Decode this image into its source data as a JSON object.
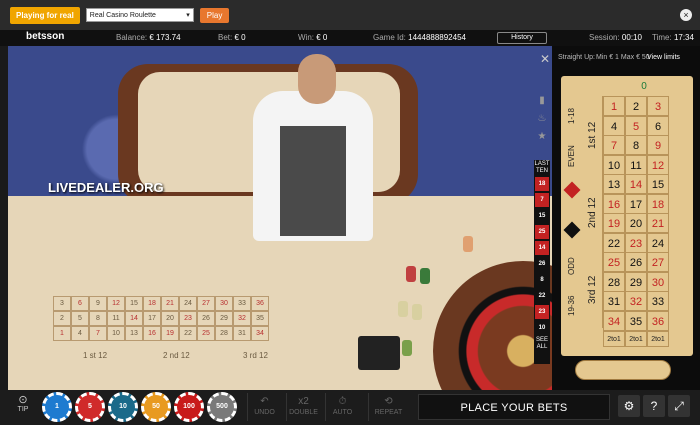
{
  "topbar": {
    "mode_button": "Playing for real",
    "game_select": "Real Casino Roulette",
    "play_button": "Play",
    "close_icon": "close-icon"
  },
  "infobar": {
    "brand": "betsson",
    "balance_label": "Balance:",
    "balance_value": "€ 173.74",
    "bet_label": "Bet:",
    "bet_value": "€ 0",
    "win_label": "Win:",
    "win_value": "€ 0",
    "game_id_label": "Game Id:",
    "game_id_value": "1444888892454",
    "history_button": "History",
    "session_label": "Session:",
    "session_value": "00:10",
    "time_label": "Time:",
    "time_value": "17:34"
  },
  "video": {
    "watermark": "LIVEDEALER.ORG"
  },
  "felt_board": {
    "dozens": [
      "1 st 12",
      "2 nd 12",
      "3 rd 12"
    ]
  },
  "last_ten": {
    "header": "LAST TEN",
    "numbers": [
      {
        "n": "18",
        "color": "#c32222"
      },
      {
        "n": "7",
        "color": "#c32222"
      },
      {
        "n": "15",
        "color": "#111111"
      },
      {
        "n": "25",
        "color": "#c32222"
      },
      {
        "n": "14",
        "color": "#c32222"
      },
      {
        "n": "26",
        "color": "#111111"
      },
      {
        "n": "8",
        "color": "#111111"
      },
      {
        "n": "22",
        "color": "#111111"
      },
      {
        "n": "23",
        "color": "#c32222"
      },
      {
        "n": "10",
        "color": "#111111"
      }
    ],
    "footer": "SEE ALL"
  },
  "panel": {
    "straight_up": "Straight Up:",
    "minmax": "Min € 1 Max € 50",
    "view_limits": "View limits",
    "zero": "0",
    "outside_bets": [
      "1-18",
      "EVEN",
      "ODD",
      "19-36"
    ],
    "dozens": [
      "1st 12",
      "2nd 12",
      "3rd 12"
    ],
    "column_bets": [
      "2to1",
      "2to1",
      "2to1"
    ],
    "red_numbers": [
      1,
      3,
      5,
      7,
      9,
      12,
      14,
      16,
      18,
      19,
      21,
      23,
      25,
      27,
      30,
      32,
      34,
      36
    ]
  },
  "bottombar": {
    "tip_label": "TIP",
    "chips": [
      {
        "value": "1",
        "color": "#1e7bd0"
      },
      {
        "value": "5",
        "color": "#d02a2a"
      },
      {
        "value": "10",
        "color": "#1a6a8a"
      },
      {
        "value": "50",
        "color": "#e89a20"
      },
      {
        "value": "100",
        "color": "#c81a1a"
      },
      {
        "value": "500",
        "color": "#7a7a7a"
      }
    ],
    "undo": "UNDO",
    "double": "DOUBLE",
    "double_glyph": "x2",
    "auto": "AUTO",
    "repeat": "REPEAT",
    "place_bets": "PLACE YOUR BETS",
    "settings_icon": "gear-icon",
    "help_icon": "help-icon",
    "fullscreen_icon": "fullscreen-icon"
  }
}
